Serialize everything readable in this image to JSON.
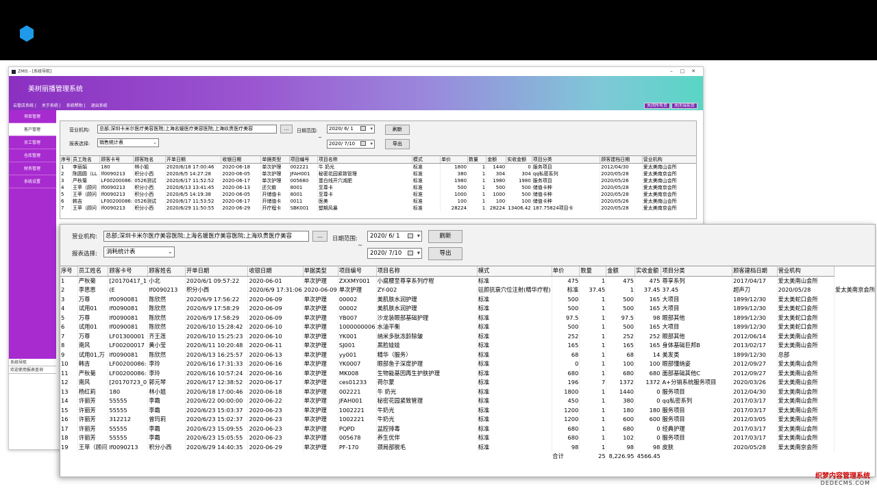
{
  "app": {
    "title": "ZMIS - [系统导航]",
    "banner_title": "美树丽播管理系统",
    "menu": [
      "云管店系统",
      "关于系统",
      "系统帮助",
      "退出系统"
    ],
    "banner_buttons": [
      "关闭所有页",
      "关闭当前页"
    ],
    "sidebar": [
      "项目管理",
      "客户管理",
      "员工管理",
      "仓库管理",
      "财务管理",
      "系统设置"
    ],
    "sidebar_active": 1,
    "sidebar_bottom": [
      "系统导航",
      "欢迎使用报表查询"
    ]
  },
  "panel1": {
    "org_label": "营业机构:",
    "org_value": "总部;深圳卡米尔医疗美容医院;上海名媛医疗美容医院;上海玖贵医疗美容",
    "browse_label": "...",
    "date_label": "日期范围:",
    "date_from": "2020/ 6/ 1",
    "date_to": "2020/ 7/10",
    "tilde": "~",
    "refresh_label": "刷新",
    "export_label": "导出",
    "report_label": "报表选择:",
    "report_value": "销售统计表",
    "columns": [
      "序号",
      "员工姓名",
      "顾客卡号",
      "顾客姓名",
      "开单日期",
      "收银日期",
      "单据类型",
      "项目编号",
      "项目名称",
      "模式",
      "单价",
      "数量",
      "金额",
      "实收金额",
      "项目分类",
      "顾客建档日期",
      "营业机构"
    ],
    "rows": [
      [
        "1",
        "李丽娟",
        "180",
        "林小姐",
        "2020/6/18 17:00:46",
        "2020-06-18",
        "单次护理",
        "002221",
        "牛 奶光",
        "标准",
        "1800",
        "1",
        "1440",
        "0",
        "服务项目",
        "2012/04/30",
        "爱太美南山会所"
      ],
      [
        "2",
        "陈圆圆（LL",
        "lf0090213",
        "积分小西",
        "2020/6/5 14:27:28",
        "2020-06-05",
        "单次护理",
        "JFAH001",
        "秘密花园紧致管理",
        "标准",
        "380",
        "1",
        "304",
        "304",
        "qq私密系列",
        "2020/05/28",
        "爱太美南京会所"
      ],
      [
        "3",
        "严秋菊",
        "LF00200086:",
        "0526测试",
        "2020/6/17 11:52:52",
        "2020-06-17",
        "单次护理",
        "005680",
        "蛋白线开穴减肥",
        "标准",
        "1980",
        "1",
        "1980",
        "1980",
        "服务项目",
        "2020/05/26",
        "爱太美南山会所"
      ],
      [
        "4",
        "王苹（顾问",
        "lf0090213",
        "积分小西",
        "2020/6/13 13:41:45",
        "2020-06-13",
        "还欠款",
        "8001",
        "至尊卡",
        "标准",
        "500",
        "1",
        "500",
        "500",
        "储值卡种",
        "2020/05/28",
        "爱太美南京会所"
      ],
      [
        "5",
        "王苹（顾问",
        "lf0090213",
        "积分小西",
        "2020/6/5 14:19:38",
        "2020-06-05",
        "开储值卡",
        "8001",
        "至尊卡",
        "标准",
        "1000",
        "1",
        "1000",
        "500",
        "储值卡种",
        "2020/05/28",
        "爱太美南京会所"
      ],
      [
        "6",
        "韩吉",
        "LF00200086:",
        "0526测试",
        "2020/6/17 11:53:52",
        "2020-06-17",
        "开储值卡",
        "0011",
        "医美",
        "标准",
        "100",
        "1",
        "100",
        "100",
        "储值卡种",
        "2020/05/26",
        "爱太美南山会所"
      ],
      [
        "7",
        "王苹（顾问",
        "lf0090213",
        "积分小西",
        "2020/6/29 11:50:55",
        "2020-06-29",
        "开疗程卡",
        "SBK001",
        "塑期风暴",
        "标准",
        "28224",
        "1",
        "28224",
        "13406.42",
        "187.75824项目卡",
        "2020/05/28",
        "爱太美南京会所"
      ]
    ]
  },
  "panel2": {
    "org_label": "营业机构:",
    "org_value": "总部;深圳卡米尔医疗美容医院;上海名媛医疗美容医院;上海玖贵医疗美容",
    "browse_label": "...",
    "date_label": "日期范围:",
    "date_from": "2020/ 6/ 1",
    "date_to": "2020/ 7/10",
    "tilde": "~",
    "refresh_label": "刷新",
    "export_label": "导出",
    "report_label": "报表选择:",
    "report_value": "消耗统计表",
    "columns": [
      "序号",
      "员工姓名",
      "顾客卡号",
      "顾客姓名",
      "开单日期",
      "收银日期",
      "单据类型",
      "项目编号",
      "项目名称",
      "模式",
      "单价",
      "数量",
      "金额",
      "实收金额",
      "项目分类",
      "顾客建档日期",
      "营业机构"
    ],
    "rows": [
      [
        "1",
        "严秋菊",
        "[20170417_1",
        "小北",
        "2020/6/1 09:57:22",
        "2020-06-01",
        "单次护理",
        "ZXXMY001",
        "小腐腰至尊享系列疗程",
        "标准",
        "475",
        "1",
        "475",
        "475",
        "尊享系列",
        "2017/04/17",
        "爱太美南山会所"
      ],
      [
        "2",
        "李思思",
        "(E",
        "lf0090213",
        "积分小西",
        "2020/6/9 17:31:06",
        "2020-06-09",
        "单次护理",
        "ZY-002",
        "驻颜抗衰穴位注射(精华疗程)",
        "标准",
        "37.45",
        "1",
        "37.45",
        "37.45",
        "超声刀",
        "2020/05/28",
        "爱太美南京会所"
      ],
      [
        "3",
        "万尊",
        "lf0090081",
        "陈欣然",
        "2020/6/9 17:56:22",
        "2020-06-09",
        "单次护理",
        "00002",
        "美肌肤水润护理",
        "标准",
        "500",
        "1",
        "500",
        "165",
        "大项目",
        "1899/12/30",
        "爱太美蛇口会所"
      ],
      [
        "4",
        "试用01",
        "lf0090081",
        "陈欣然",
        "2020/6/9 17:58:29",
        "2020-06-09",
        "单次护理",
        "00002",
        "美肌肤水润护理",
        "标准",
        "500",
        "1",
        "500",
        "165",
        "大项目",
        "1899/12/30",
        "爱太美蛇口会所"
      ],
      [
        "5",
        "万尊",
        "lf0090081",
        "陈欣然",
        "2020/6/9 17:58:29",
        "2020-06-09",
        "单次护理",
        "YB007",
        "沙龙装眼部基础护理",
        "标准",
        "97.5",
        "1",
        "97.5",
        "98",
        "眼部其他",
        "1899/12/30",
        "爱太美蛇口会所"
      ],
      [
        "6",
        "试用01",
        "lf0090081",
        "陈欣然",
        "2020/6/10 15:28:42",
        "2020-06-10",
        "单次护理",
        "1000000006",
        "水油平衡",
        "标准",
        "500",
        "1",
        "500",
        "165",
        "大项目",
        "1899/12/30",
        "爱太美蛇口会所"
      ],
      [
        "7",
        "万尊",
        "LF01300001",
        "齐王莲",
        "2020/6/10 15:25:23",
        "2020-06-10",
        "单次护理",
        "YK001",
        "纳米多肽冻龄除皱",
        "标准",
        "252",
        "1",
        "252",
        "252",
        "眼部其他",
        "2012/06/14",
        "爱太美南山会所"
      ],
      [
        "8",
        "南风",
        "LF00200017",
        "黄小莹",
        "2020/6/11 10:20:48",
        "2020-06-11",
        "单次护理",
        "SJ001",
        "黑脸娃娃",
        "标准",
        "165",
        "1",
        "165",
        "165",
        "身体基础巨邦B",
        "2013/02/17",
        "爱太美南山会所"
      ],
      [
        "9",
        "试用01,万",
        "lf0090081",
        "陈欣然",
        "2020/6/13 16:25:57",
        "2020-06-13",
        "单次护理",
        "yy001",
        "精华（服务）",
        "标准",
        "68",
        "1",
        "68",
        "14",
        "美发类",
        "1899/12/30",
        "总部"
      ],
      [
        "10",
        "韩吉",
        "LF00200086:",
        "李玲",
        "2020/6/16 17:31:33",
        "2020-06-16",
        "单次护理",
        "YK0007",
        "眼部鱼子深度护理",
        "标准",
        "0",
        "1",
        "100",
        "100",
        "眼部懂纳姿",
        "2012/09/27",
        "爱太美南山会所"
      ],
      [
        "11",
        "严秋菊",
        "LF00200086:",
        "李玲",
        "2020/6/16 10:57:24",
        "2020-06-16",
        "单次护理",
        "MK008",
        "生物能基因再生护肤护理",
        "标准",
        "680",
        "1",
        "680",
        "680",
        "面部基础其他C",
        "2012/09/27",
        "爱太美南山会所"
      ],
      [
        "12",
        "南风",
        "[20170723_0",
        "郭元琴",
        "2020/6/17 12:38:52",
        "2020-06-17",
        "单次护理",
        "ces01233",
        "荷尔蒙",
        "标准",
        "196",
        "7",
        "1372",
        "1372",
        "A+分销系统服务项目",
        "2020/03/26",
        "爱太美南山会所"
      ],
      [
        "13",
        "杨红莉",
        "180",
        "林小姐",
        "2020/6/18 17:00:46",
        "2020-06-18",
        "单次护理",
        "002221",
        "牛 奶光",
        "标准",
        "1800",
        "1",
        "1440",
        "0",
        "服务项目",
        "2012/04/30",
        "爱太美南山会所"
      ],
      [
        "14",
        "许丽芳",
        "55555",
        "李霸",
        "2020/6/22 00:00:00",
        "2020-06-22",
        "单次护理",
        "JFAH001",
        "秘密花园紧致管理",
        "标准",
        "450",
        "1",
        "380",
        "0",
        "qq私密系列",
        "2017/03/17",
        "爱太美南山会所"
      ],
      [
        "15",
        "许丽芳",
        "55555",
        "李霸",
        "2020/6/23 15:03:37",
        "2020-06-23",
        "单次护理",
        "1002221",
        "牛奶光",
        "标准",
        "1200",
        "1",
        "180",
        "180",
        "服务项目",
        "2017/03/17",
        "爱太美南山会所"
      ],
      [
        "16",
        "许丽芳",
        "312212",
        "曾玛莉",
        "2020/6/23 15:02:37",
        "2020-06-23",
        "单次护理",
        "1002221",
        "牛奶光",
        "标准",
        "1200",
        "1",
        "600",
        "600",
        "服务项目",
        "2012/03/05",
        "爱太美南山会所"
      ],
      [
        "17",
        "许丽芳",
        "55555",
        "李霸",
        "2020/6/23 15:09:55",
        "2020-06-23",
        "单次护理",
        "PQPD",
        "盆腔排毒",
        "标准",
        "680",
        "1",
        "680",
        "0",
        "经典护理",
        "2017/03/17",
        "爱太美南山会所"
      ],
      [
        "18",
        "许丽芳",
        "55555",
        "李霸",
        "2020/6/23 15:05:55",
        "2020-06-23",
        "单次护理",
        "005678",
        "养生优伴",
        "标准",
        "680",
        "1",
        "102",
        "0",
        "服务项目",
        "2017/03/17",
        "爱太美南山会所"
      ],
      [
        "19",
        "王苹（顾问",
        "lf0090213",
        "积分小西",
        "2020/6/29 14:40:35",
        "2020-06-29",
        "单次护理",
        "PF-170",
        "颈局部脱毛",
        "标准",
        "98",
        "1",
        "98",
        "98",
        "皮肤",
        "2020/05/28",
        "爱太美南京会所"
      ]
    ],
    "total_label": "合计",
    "total_qty": "25",
    "total_amount": "8,226.95",
    "total_received": "4566.45"
  },
  "watermark": {
    "line1": "织梦内容管理系统",
    "line2": "DEDECMS.COM"
  },
  "colors": {
    "banner_start": "#8b2fc1",
    "banner_end": "#58d6c4",
    "sidebar": "#a82bd0"
  }
}
